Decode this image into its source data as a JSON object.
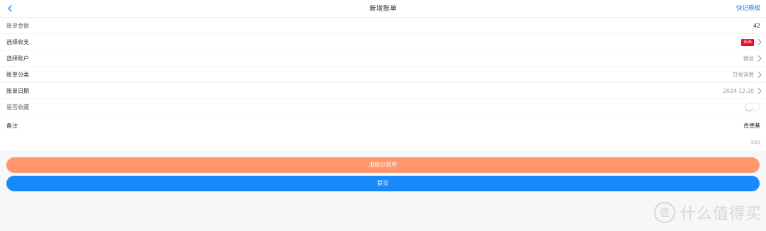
{
  "header": {
    "title": "新增账单",
    "right_action": "快记模板"
  },
  "form": {
    "amount": {
      "label": "账单金额",
      "value": "42"
    },
    "type": {
      "label": "选择收支",
      "value": "支出"
    },
    "account": {
      "label": "选择账户",
      "value": "微信"
    },
    "category": {
      "label": "账单分类",
      "value": "日常消费"
    },
    "date": {
      "label": "账单日期",
      "value": "2024-12-20"
    },
    "favorite": {
      "label": "是否收藏",
      "on": false
    },
    "note": {
      "label": "备注",
      "value": "肯德基",
      "count": "3/50"
    }
  },
  "buttons": {
    "add_split": "追加分账单",
    "submit": "提交"
  },
  "watermark": {
    "text": "什么值得买",
    "logo_char": "值"
  },
  "colors": {
    "link": "#1989fa",
    "tag": "#ee0a24",
    "add_button": "#ff976a",
    "submit_button": "#1989fa",
    "page_bg": "#f6f7f9"
  }
}
